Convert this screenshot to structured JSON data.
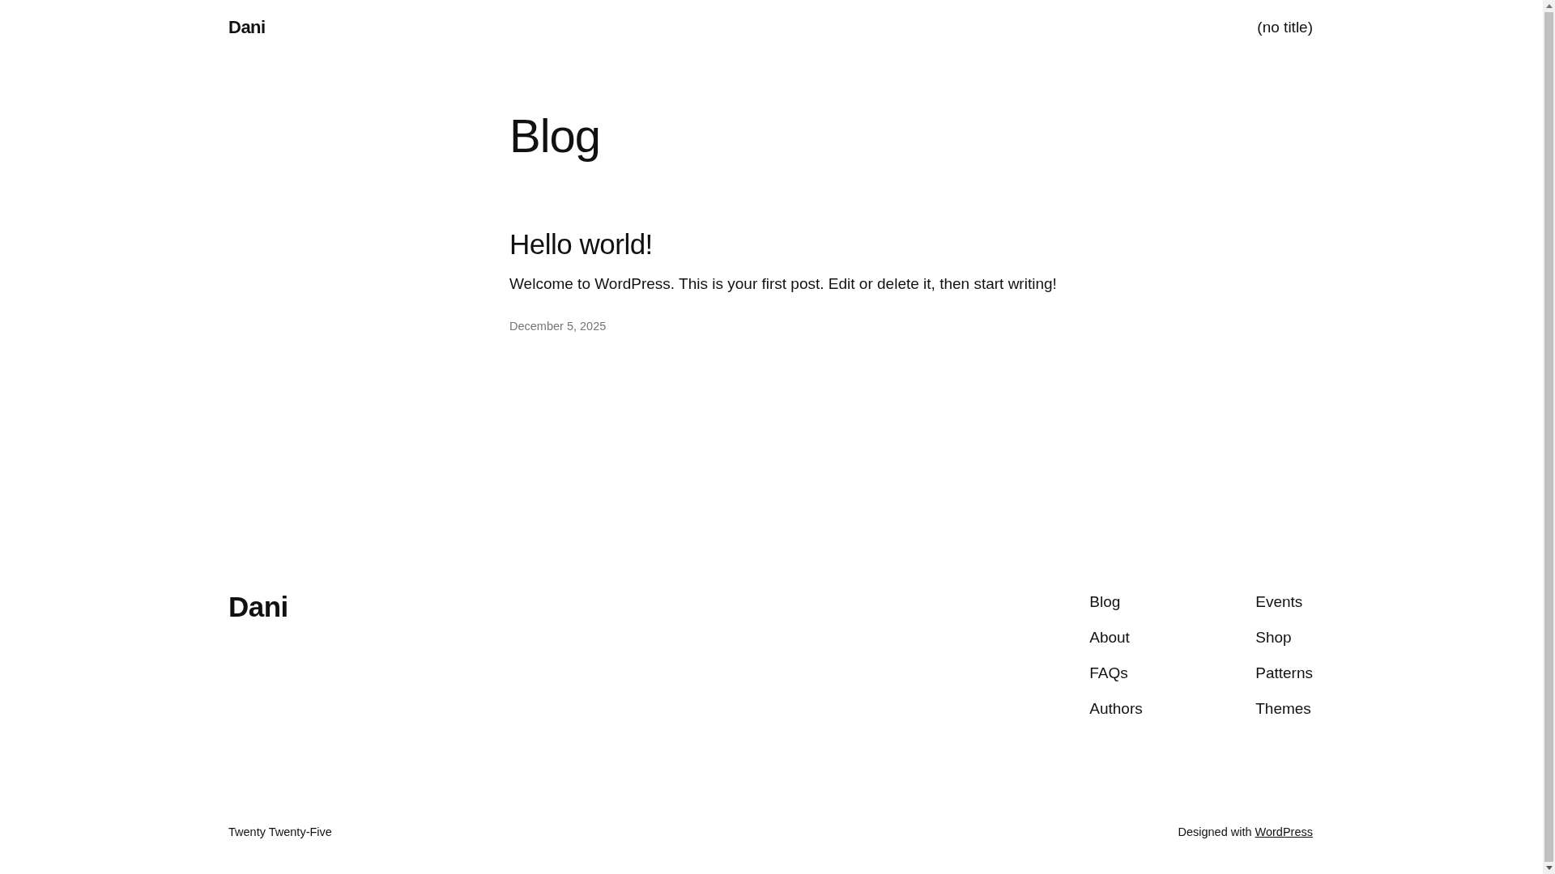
{
  "header": {
    "site_title": "Dani",
    "nav": [
      {
        "label": "(no title)"
      }
    ]
  },
  "page_title": "Blog",
  "posts": [
    {
      "title": "Hello world!",
      "excerpt": "Welcome to WordPress. This is your first post. Edit or delete it, then start writing!",
      "date": "December 5, 2025"
    }
  ],
  "footer": {
    "site_title": "Dani",
    "nav_columns": [
      [
        "Blog",
        "About",
        "FAQs",
        "Authors"
      ],
      [
        "Events",
        "Shop",
        "Patterns",
        "Themes"
      ]
    ],
    "theme_credit": "Twenty Twenty-Five",
    "credit": {
      "text": "Designed with",
      "link": "WordPress"
    }
  }
}
